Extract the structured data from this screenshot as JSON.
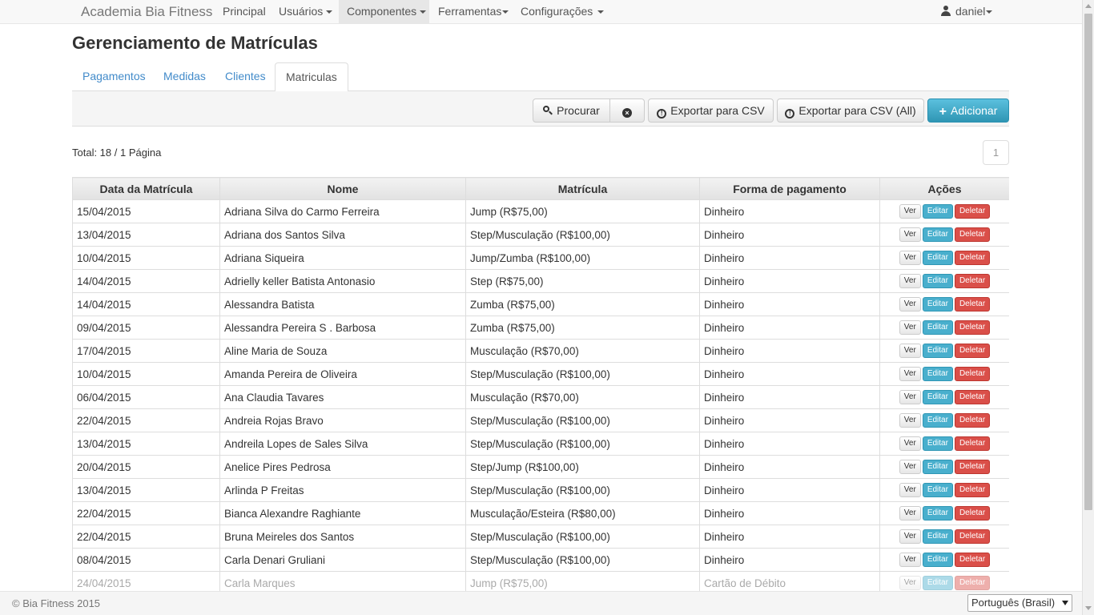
{
  "navbar": {
    "brand": "Academia Bia Fitness",
    "items": [
      {
        "label": "Principal"
      },
      {
        "label": "Usuários"
      },
      {
        "label": "Componentes"
      },
      {
        "label": "Ferramentas"
      },
      {
        "label": "Configurações"
      }
    ],
    "user": "daniel"
  },
  "page": {
    "title": "Gerenciamento de Matrículas"
  },
  "tabs": [
    {
      "label": "Pagamentos"
    },
    {
      "label": "Medidas"
    },
    {
      "label": "Clientes"
    },
    {
      "label": "Matriculas"
    }
  ],
  "toolbar": {
    "search": "Procurar",
    "export_csv": "Exportar para CSV",
    "export_csv_all": "Exportar para CSV (All)",
    "add": "Adicionar"
  },
  "summary": {
    "total": "Total: 18 / 1 Página",
    "page": "1"
  },
  "table": {
    "headers": [
      "Data da Matrícula",
      "Nome",
      "Matrícula",
      "Forma de pagamento",
      "Ações"
    ],
    "action_labels": {
      "view": "Ver",
      "edit": "Editar",
      "delete": "Deletar"
    },
    "rows": [
      [
        "15/04/2015",
        "Adriana Silva do Carmo Ferreira",
        "Jump (R$75,00)",
        "Dinheiro"
      ],
      [
        "13/04/2015",
        "Adriana dos Santos Silva",
        "Step/Musculação (R$100,00)",
        "Dinheiro"
      ],
      [
        "10/04/2015",
        "Adriana Siqueira",
        "Jump/Zumba (R$100,00)",
        "Dinheiro"
      ],
      [
        "14/04/2015",
        "Adrielly keller Batista Antonasio",
        "Step (R$75,00)",
        "Dinheiro"
      ],
      [
        "14/04/2015",
        "Alessandra Batista",
        "Zumba (R$75,00)",
        "Dinheiro"
      ],
      [
        "09/04/2015",
        "Alessandra Pereira S . Barbosa",
        "Zumba (R$75,00)",
        "Dinheiro"
      ],
      [
        "17/04/2015",
        "Aline Maria de Souza",
        "Musculação (R$70,00)",
        "Dinheiro"
      ],
      [
        "10/04/2015",
        "Amanda Pereira de Oliveira",
        "Step/Musculação (R$100,00)",
        "Dinheiro"
      ],
      [
        "06/04/2015",
        "Ana Claudia Tavares",
        "Musculação (R$70,00)",
        "Dinheiro"
      ],
      [
        "22/04/2015",
        "Andreia Rojas Bravo",
        "Step/Musculação (R$100,00)",
        "Dinheiro"
      ],
      [
        "13/04/2015",
        "Andreila Lopes de Sales Silva",
        "Step/Musculação (R$100,00)",
        "Dinheiro"
      ],
      [
        "20/04/2015",
        "Anelice Pires Pedrosa",
        "Step/Jump (R$100,00)",
        "Dinheiro"
      ],
      [
        "13/04/2015",
        "Arlinda P Freitas",
        "Step/Musculação (R$100,00)",
        "Dinheiro"
      ],
      [
        "22/04/2015",
        "Bianca Alexandre Raghiante",
        "Musculação/Esteira (R$80,00)",
        "Dinheiro"
      ],
      [
        "22/04/2015",
        "Bruna Meireles dos Santos",
        "Step/Musculação (R$100,00)",
        "Dinheiro"
      ],
      [
        "08/04/2015",
        "Carla Denari Gruliani",
        "Step/Musculação (R$100,00)",
        "Dinheiro"
      ],
      [
        "24/04/2015",
        "Carla Marques",
        "Jump (R$75,00)",
        "Cartão de Débito"
      ]
    ]
  },
  "footer": {
    "copyright": "© Bia Fitness 2015",
    "language": "Português (Brasil)"
  }
}
